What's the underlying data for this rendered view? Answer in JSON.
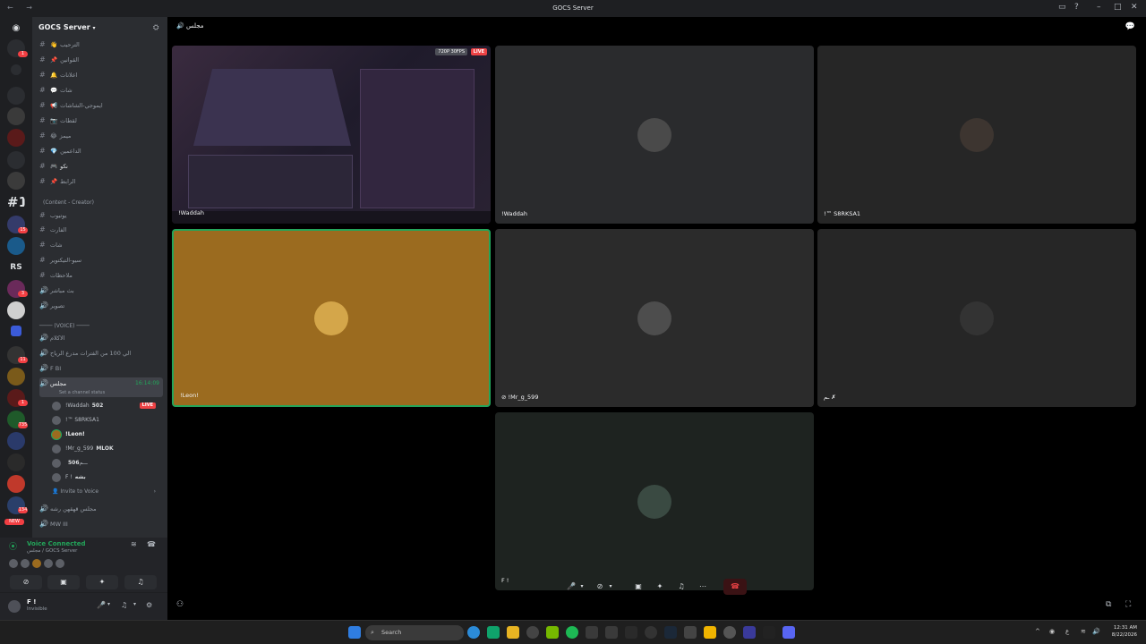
{
  "window": {
    "title": "GOCS Server"
  },
  "server": {
    "name": "GOCS Server"
  },
  "rail": {
    "items": [
      "",
      "",
      "",
      "",
      "",
      "",
      "",
      "",
      "#1",
      "",
      "",
      "RS",
      "",
      "",
      "",
      "",
      "",
      "",
      "",
      "",
      "",
      "",
      "",
      "",
      "",
      ""
    ],
    "badges": [
      {
        "text": "1"
      },
      {
        "text": "15"
      },
      {
        "text": "3"
      },
      {
        "text": "11"
      },
      {
        "text": "1"
      },
      {
        "text": "735"
      },
      {
        "text": "134"
      }
    ],
    "new_label": "NEW"
  },
  "channels_top": [
    {
      "emoji": "👋",
      "name": "الترحيب"
    },
    {
      "emoji": "📌",
      "name": "القوانين"
    },
    {
      "emoji": "🔔",
      "name": "اعلانات"
    },
    {
      "emoji": "💬",
      "name": "شات"
    },
    {
      "emoji": "📢",
      "name": "ايموجي-الشاشات"
    },
    {
      "emoji": "📷",
      "name": "لقطات"
    },
    {
      "emoji": "😂",
      "name": "ميمز"
    },
    {
      "emoji": "💎",
      "name": "الداعمين"
    },
    {
      "emoji": "🎮",
      "name": "نكو"
    },
    {
      "emoji": "📌",
      "name": "الرابط"
    }
  ],
  "category_creator": "(Content - Creator)",
  "channels_creator": [
    {
      "name": "يوتيوب"
    },
    {
      "name": "الفارت"
    },
    {
      "name": "شات"
    },
    {
      "name": "سيو-التيكتوير"
    },
    {
      "name": "ملاحظات"
    },
    {
      "name": "بث مباشر"
    },
    {
      "name": "تصوير"
    }
  ],
  "category_voice": "(VOICE)",
  "voice_channels": [
    {
      "name": "الاكلام"
    },
    {
      "name": "الي 100 من الفترات مدرع الرياح"
    },
    {
      "name": "F BI"
    }
  ],
  "active_voice": {
    "name": "مجلس",
    "time": "16:14:09",
    "status": "Set a channel status"
  },
  "voice_users": [
    {
      "name": "!Waddah",
      "tag": "502",
      "live": "LIVE"
    },
    {
      "name": "!™ S8RKSA1",
      "tag": "",
      "live": ""
    },
    {
      "name": "!Leon!",
      "tag": "",
      "live": ""
    },
    {
      "name": "!Mr_g_599",
      "tag": "MLOK",
      "live": ""
    },
    {
      "name": "ـــم",
      "tag": "506",
      "live": ""
    },
    {
      "name": "F !",
      "tag": "بشه",
      "live": ""
    }
  ],
  "invite_to_voice": "Invite to Voice",
  "voice_channels_bottom": [
    {
      "name": "مجلس قهقهن رشه"
    },
    {
      "name": "MW III"
    }
  ],
  "voice_connected": {
    "title": "Voice Connected",
    "subtitle": "مجلس / GOCS Server"
  },
  "user": {
    "name": "F !",
    "status": "Invisible"
  },
  "main": {
    "channel_title": "مجلس",
    "stream_quality": "720P 30FPS",
    "stream_live": "LIVE",
    "tiles": [
      {
        "name": "!Waddah",
        "bg": "#2a2b2d"
      },
      {
        "name": "!Waddah",
        "bg": "#252525"
      },
      {
        "name": "!™ S8RKSA1",
        "bg": "#262626"
      },
      {
        "name": "!Leon!",
        "bg": "#9b6b1f"
      },
      {
        "name": "!Mr_g_599",
        "bg": "#2b2b2b"
      },
      {
        "name": "ـم ✗",
        "bg": "#262626"
      },
      {
        "name": "F !",
        "bg": "#1e2320"
      }
    ]
  },
  "taskbar": {
    "search_placeholder": "Search",
    "time": "12:31 AM",
    "date": "8/22/2026"
  },
  "colors": {
    "speaking": "#23a55a",
    "live": "#ed4245",
    "sidebar": "#2b2d31",
    "rail": "#1e1f22"
  }
}
